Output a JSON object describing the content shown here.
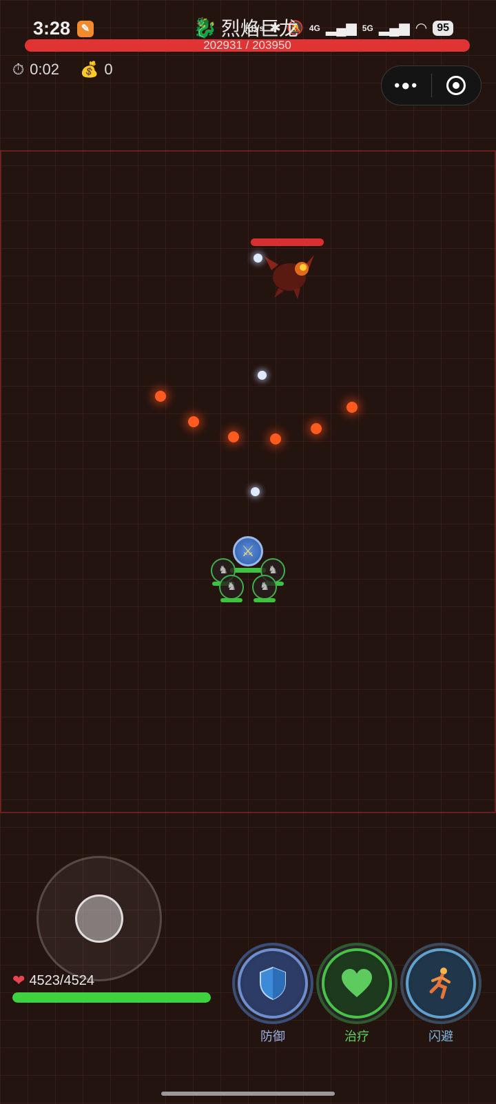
{
  "status_bar": {
    "time": "3:28",
    "network_speed": "KB/s",
    "signal_4g": "4G",
    "signal_5g": "5G",
    "battery": "95",
    "icons": [
      "bluetooth-icon",
      "mute-icon",
      "signal-icon",
      "wifi-icon"
    ]
  },
  "boss": {
    "name": "烈焰巨龙",
    "icon": "dragon-icon",
    "hp_current": 202931,
    "hp_max": 203950,
    "hp_text": "202931 / 203950",
    "hp_color": "#e03434"
  },
  "hud": {
    "timer": "0:02",
    "gold": "0",
    "timer_icon": "stopwatch-icon",
    "gold_icon": "money-bag-icon"
  },
  "capsule": {
    "more_icon": "more-dots-icon",
    "close_icon": "target-icon"
  },
  "player": {
    "hp_text": "4523/4524",
    "hp_current": 4523,
    "hp_max": 4524,
    "hp_color": "#3fd23f"
  },
  "skills": [
    {
      "label": "防御",
      "icon": "shield-icon",
      "color": "#6e8ed0"
    },
    {
      "label": "治疗",
      "icon": "heart-icon",
      "color": "#47c447"
    },
    {
      "label": "闪避",
      "icon": "running-icon",
      "color": "#5fa2d0"
    }
  ]
}
